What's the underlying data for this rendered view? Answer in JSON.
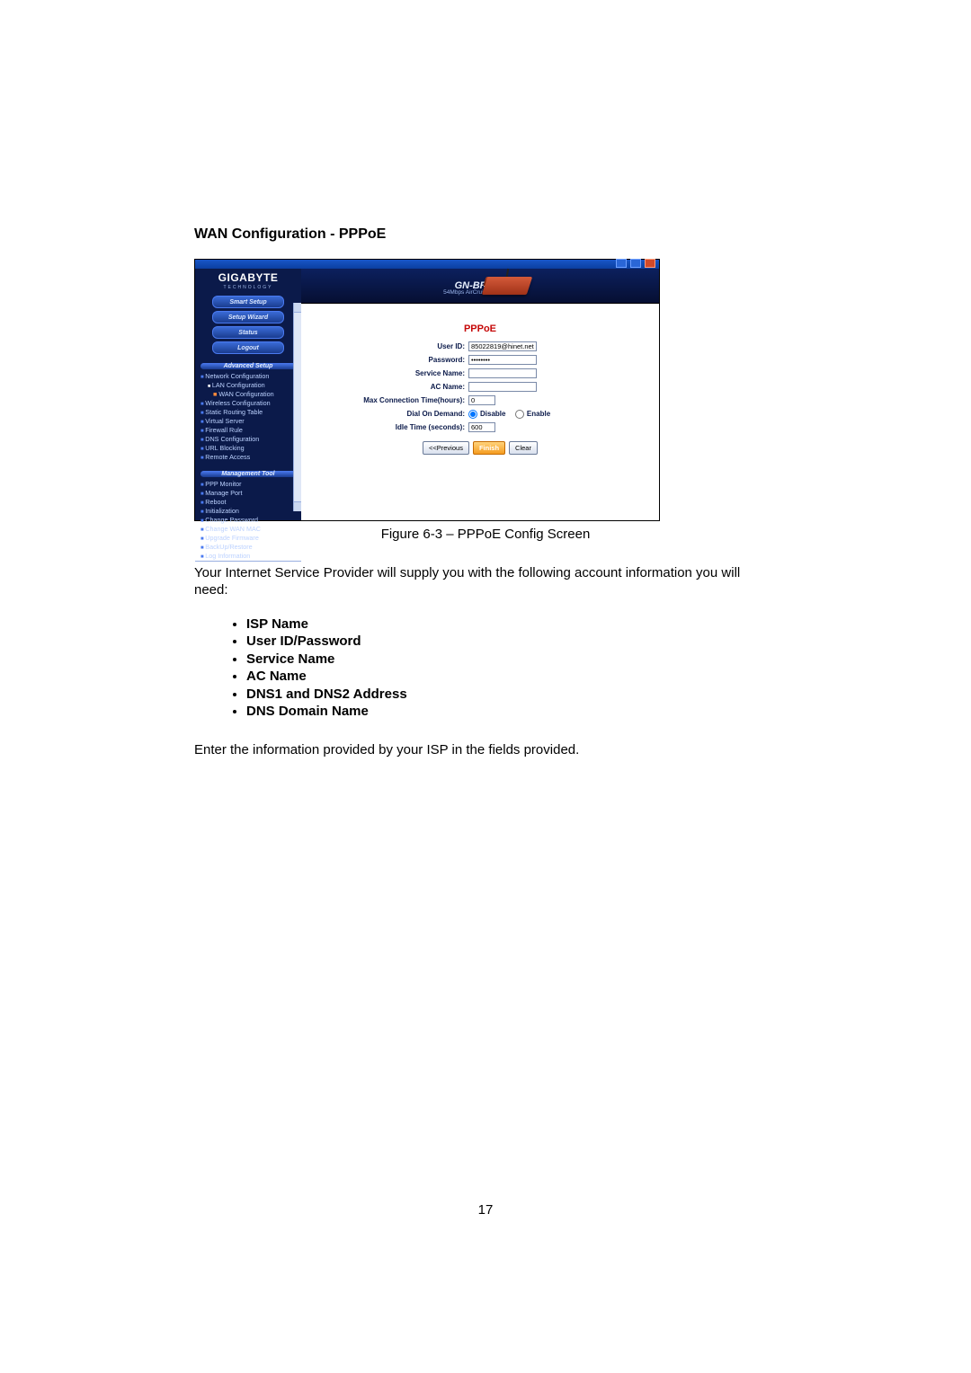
{
  "doc": {
    "section_heading": "WAN Configuration - PPPoE",
    "figure_caption": "Figure 6-3 – PPPoE Config Screen",
    "intro_paragraph": "Your Internet Service Provider will supply you with the following account information you will need:",
    "requirements": [
      "ISP Name",
      "User ID/Password",
      "Service Name",
      "AC Name",
      "DNS1 and DNS2 Address",
      "DNS Domain Name"
    ],
    "closing_paragraph": "Enter the information provided by your ISP in the fields provided.",
    "page_number": "17"
  },
  "app": {
    "brand_name": "GIGABYTE",
    "brand_sub": "TECHNOLOGY",
    "banner_model": "GN-BR01G",
    "banner_sub": "54Mbps AirCruiser G Router",
    "side_buttons": [
      "Smart Setup",
      "Setup Wizard",
      "Status",
      "Logout"
    ],
    "side_header1": "Advanced Setup",
    "side_links1": [
      {
        "label": "Network Configuration",
        "cls": "side-link"
      },
      {
        "label": "LAN Configuration",
        "cls": "side-link sub"
      },
      {
        "label": "WAN Configuration",
        "cls": "side-link sub2",
        "dot": true
      },
      {
        "label": "Wireless Configuration",
        "cls": "side-link"
      },
      {
        "label": "Static Routing Table",
        "cls": "side-link"
      },
      {
        "label": "Virtual Server",
        "cls": "side-link"
      },
      {
        "label": "Firewall Rule",
        "cls": "side-link"
      },
      {
        "label": "DNS Configuration",
        "cls": "side-link"
      },
      {
        "label": "URL Blocking",
        "cls": "side-link"
      },
      {
        "label": "Remote Access",
        "cls": "side-link"
      }
    ],
    "side_header2": "Management Tool",
    "side_links2": [
      {
        "label": "PPP Monitor",
        "cls": "side-link"
      },
      {
        "label": "Manage Port",
        "cls": "side-link"
      },
      {
        "label": "Reboot",
        "cls": "side-link"
      },
      {
        "label": "Initialization",
        "cls": "side-link"
      },
      {
        "label": "Change Password",
        "cls": "side-link"
      },
      {
        "label": "Change WAN MAC",
        "cls": "side-link"
      },
      {
        "label": "Upgrade Firmware",
        "cls": "side-link"
      },
      {
        "label": "BackUp/Restore",
        "cls": "side-link"
      },
      {
        "label": "Log Information",
        "cls": "side-link"
      }
    ]
  },
  "form": {
    "title": "PPPoE",
    "rows": {
      "user_id_label": "User ID:",
      "user_id_value": "85022819@hinet.net",
      "password_label": "Password:",
      "password_value": "••••••••",
      "service_label": "Service Name:",
      "service_value": "",
      "ac_label": "AC Name:",
      "ac_value": "",
      "maxconn_label": "Max Connection Time(hours):",
      "maxconn_value": "0",
      "dod_label": "Dial On Demand:",
      "dod_disable": "Disable",
      "dod_enable": "Enable",
      "idle_label": "Idle Time (seconds):",
      "idle_value": "600"
    },
    "buttons": {
      "prev": "<<Previous",
      "finish": "Finish",
      "clear": "Clear"
    }
  }
}
